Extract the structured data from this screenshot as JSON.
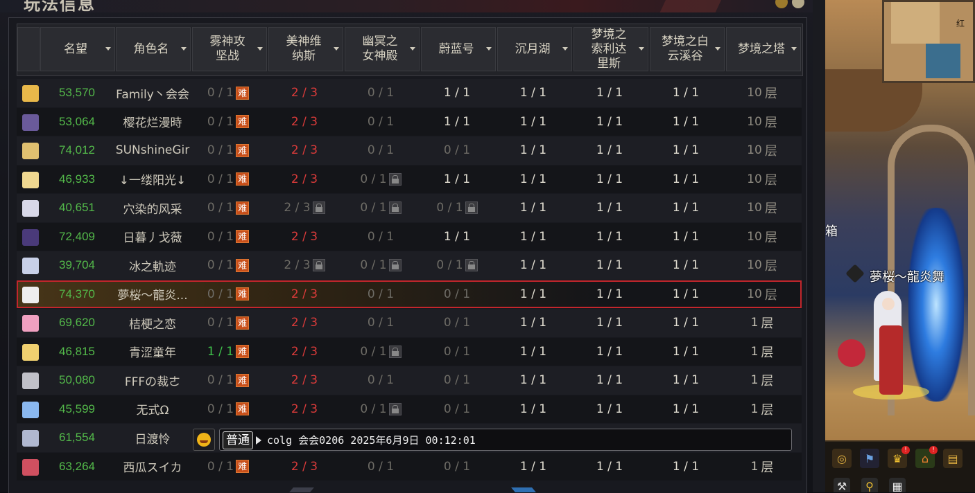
{
  "window": {
    "title": "玩法信息"
  },
  "columns": [
    {
      "label": "名望"
    },
    {
      "label": "角色名"
    },
    {
      "label": "雾神攻坚战"
    },
    {
      "label": "美神维纳斯"
    },
    {
      "label": "幽冥之女神殿"
    },
    {
      "label": "蔚蓝号"
    },
    {
      "label": "沉月湖"
    },
    {
      "label": "梦境之索利达里斯"
    },
    {
      "label": "梦境之白云溪谷"
    },
    {
      "label": "梦境之塔"
    }
  ],
  "hard_label": "难",
  "floor_unit": "层",
  "rows": [
    {
      "rep": "53,570",
      "name": "Family丶会会",
      "c1": "0 / 1",
      "c2": "2 / 3",
      "c3": "0 / 1",
      "c4": "1 / 1",
      "c5": "1 / 1",
      "c6": "1 / 1",
      "c7": "1 / 1",
      "floor": "10",
      "avatar": "#e8b84a"
    },
    {
      "rep": "53,064",
      "name": "樱花烂漫時",
      "c1": "0 / 1",
      "c2": "2 / 3",
      "c3": "0 / 1",
      "c4": "1 / 1",
      "c5": "1 / 1",
      "c6": "1 / 1",
      "c7": "1 / 1",
      "floor": "10",
      "avatar": "#6a5a9a"
    },
    {
      "rep": "74,012",
      "name": "SUNshineGir",
      "c1": "0 / 1",
      "c2": "2 / 3",
      "c3": "0 / 1",
      "c4": "0 / 1",
      "c5": "1 / 1",
      "c6": "1 / 1",
      "c7": "1 / 1",
      "floor": "10",
      "avatar": "#e0c070"
    },
    {
      "rep": "46,933",
      "name": "↓一缕阳光↓",
      "c1": "0 / 1",
      "c2": "2 / 3",
      "c3": "0 / 1",
      "c4": "1 / 1",
      "c5": "1 / 1",
      "c6": "1 / 1",
      "c7": "1 / 1",
      "floor": "10",
      "avatar": "#f0d890"
    },
    {
      "rep": "40,651",
      "name": "穴染的风采",
      "c1": "0 / 1",
      "c2": "2 / 3",
      "c3": "0 / 1",
      "c4": "0 / 1",
      "c5": "1 / 1",
      "c6": "1 / 1",
      "c7": "1 / 1",
      "floor": "10",
      "avatar": "#d8d8e8"
    },
    {
      "rep": "72,409",
      "name": "日暮丿戈薇",
      "c1": "0 / 1",
      "c2": "2 / 3",
      "c3": "0 / 1",
      "c4": "1 / 1",
      "c5": "1 / 1",
      "c6": "1 / 1",
      "c7": "1 / 1",
      "floor": "10",
      "avatar": "#4a3a7a"
    },
    {
      "rep": "39,704",
      "name": "冰之軌迹",
      "c1": "0 / 1",
      "c2": "2 / 3",
      "c3": "0 / 1",
      "c4": "0 / 1",
      "c5": "1 / 1",
      "c6": "1 / 1",
      "c7": "1 / 1",
      "floor": "10",
      "avatar": "#c8d0e8"
    },
    {
      "rep": "74,370",
      "name": "夢桜～龍炎...",
      "c1": "0 / 1",
      "c2": "2 / 3",
      "c3": "0 / 1",
      "c4": "0 / 1",
      "c5": "1 / 1",
      "c6": "1 / 1",
      "c7": "1 / 1",
      "floor": "10",
      "avatar": "#eeeeee"
    },
    {
      "rep": "69,620",
      "name": "桔梗之恋",
      "c1": "0 / 1",
      "c2": "2 / 3",
      "c3": "0 / 1",
      "c4": "0 / 1",
      "c5": "1 / 1",
      "c6": "1 / 1",
      "c7": "1 / 1",
      "floor": "1",
      "avatar": "#f0a0c0"
    },
    {
      "rep": "46,815",
      "name": "青涩童年",
      "c1": "1 / 1",
      "c2": "2 / 3",
      "c3": "0 / 1",
      "c4": "0 / 1",
      "c5": "1 / 1",
      "c6": "1 / 1",
      "c7": "1 / 1",
      "floor": "1",
      "avatar": "#f0d070"
    },
    {
      "rep": "50,080",
      "name": "FFFの裁ㄜ",
      "c1": "0 / 1",
      "c2": "2 / 3",
      "c3": "0 / 1",
      "c4": "0 / 1",
      "c5": "1 / 1",
      "c6": "1 / 1",
      "c7": "1 / 1",
      "floor": "1",
      "avatar": "#c0c0c8"
    },
    {
      "rep": "45,599",
      "name": "无式Ω",
      "c1": "0 / 1",
      "c2": "2 / 3",
      "c3": "0 / 1",
      "c4": "0 / 1",
      "c5": "1 / 1",
      "c6": "1 / 1",
      "c7": "1 / 1",
      "floor": "1",
      "avatar": "#8ab8f0"
    },
    {
      "rep": "61,554",
      "name": "日渡怜",
      "c1": "",
      "c2": "",
      "c3": "",
      "c4": "",
      "c5": "",
      "c6": "",
      "c7": "",
      "floor": "",
      "avatar": "#b0b8d0"
    },
    {
      "rep": "63,264",
      "name": "西瓜スイカ",
      "c1": "0 / 1",
      "c2": "2 / 3",
      "c3": "0 / 1",
      "c4": "0 / 1",
      "c5": "1 / 1",
      "c6": "1 / 1",
      "c7": "1 / 1",
      "floor": "1",
      "avatar": "#d05060"
    }
  ],
  "chat": {
    "mode": "普通",
    "text": "colg 会会0206 2025年6月9日 00:12:01"
  },
  "scene": {
    "npc_name": "夢桜～龍炎舞",
    "side_label": "箱",
    "minimap_label": "红"
  }
}
